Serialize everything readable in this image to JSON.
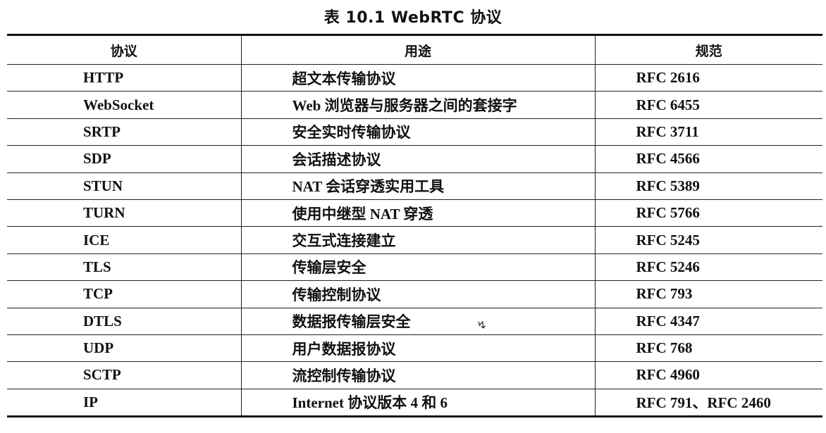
{
  "caption": "表 10.1    WebRTC 协议",
  "table": {
    "headers": {
      "protocol": "协议",
      "usage": "用途",
      "spec": "规范"
    },
    "rows": [
      {
        "protocol": "HTTP",
        "usage": "超文本传输协议",
        "spec": "RFC 2616"
      },
      {
        "protocol": "WebSocket",
        "usage": "Web 浏览器与服务器之间的套接字",
        "spec": "RFC 6455"
      },
      {
        "protocol": "SRTP",
        "usage": "安全实时传输协议",
        "spec": "RFC 3711"
      },
      {
        "protocol": "SDP",
        "usage": "会话描述协议",
        "spec": "RFC 4566"
      },
      {
        "protocol": "STUN",
        "usage": "NAT 会话穿透实用工具",
        "spec": "RFC 5389"
      },
      {
        "protocol": "TURN",
        "usage": "使用中继型 NAT 穿透",
        "spec": "RFC 5766"
      },
      {
        "protocol": "ICE",
        "usage": "交互式连接建立",
        "spec": "RFC 5245"
      },
      {
        "protocol": "TLS",
        "usage": "传输层安全",
        "spec": "RFC 5246"
      },
      {
        "protocol": "TCP",
        "usage": "传输控制协议",
        "spec": "RFC 793"
      },
      {
        "protocol": "DTLS",
        "usage": "数据报传输层安全",
        "spec": "RFC 4347"
      },
      {
        "protocol": "UDP",
        "usage": "用户数据报协议",
        "spec": "RFC 768"
      },
      {
        "protocol": "SCTP",
        "usage": "流控制传输协议",
        "spec": "RFC 4960"
      },
      {
        "protocol": "IP",
        "usage": "Internet 协议版本 4 和 6",
        "spec": "RFC 791、RFC 2460"
      }
    ]
  }
}
